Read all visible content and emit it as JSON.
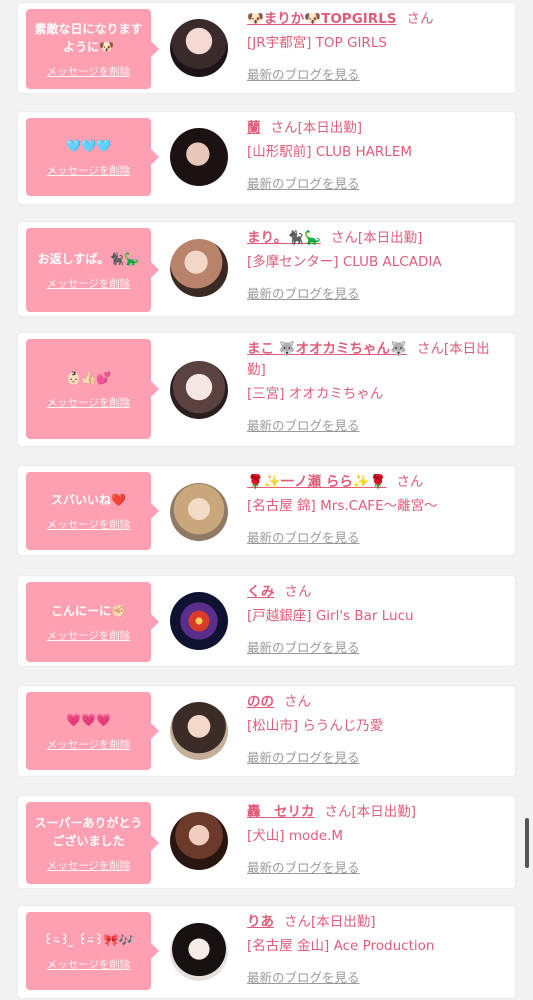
{
  "colors": {
    "accent": "#e05d7a",
    "bubble": "#ff9fb2",
    "link_gray": "#999999"
  },
  "delete_label": "メッセージを削除",
  "blog_label": "最新のブログを見る",
  "suffix_san": "さん",
  "cards": [
    {
      "message": "素敵な日になりますように🐶",
      "name": "🐶まりか🐶TOPGIRLS",
      "suffix": "",
      "shop": "[JR宇都宮] TOP GIRLS"
    },
    {
      "message": "🩵🩵🩵",
      "name": "蘭",
      "suffix": "[本日出勤]",
      "shop": "[山形駅前] CLUB HARLEM"
    },
    {
      "message": "お返しすば。🐈‍⬛🦕",
      "name": "まり。🐈‍⬛🦕",
      "suffix": "[本日出勤]",
      "shop": "[多摩センター] CLUB ALCADIA"
    },
    {
      "message": "👶🏻👍🏻💕",
      "name": "まこ 🐺オオカミちゃん🐺",
      "suffix": "[本日出勤]",
      "shop": "[三宮] オオカミちゃん"
    },
    {
      "message": "スバいいね❤️",
      "name": "🌹✨一ノ瀬 らら✨🌹",
      "suffix": "",
      "shop": "[名古屋 錦] Mrs.CAFE〜離宮〜"
    },
    {
      "message": "こんにーに✊🏻",
      "name": "くみ",
      "suffix": "",
      "shop": "[戸越銀座] Girl's Bar Lucu"
    },
    {
      "message": "💗💗💗",
      "name": "のの",
      "suffix": "",
      "shop": "[松山市] らうんじ乃愛"
    },
    {
      "message": "スーパーありがとうございました",
      "name": "轟　セリカ",
      "suffix": "[本日出勤]",
      "shop": "[犬山] mode.M"
    },
    {
      "message": "꒰⍨꒱ ̫ ꒰⍨꒱🎀🎶",
      "name": "りあ",
      "suffix": "[本日出勤]",
      "shop": "[名古屋 金山] Ace Production"
    }
  ]
}
